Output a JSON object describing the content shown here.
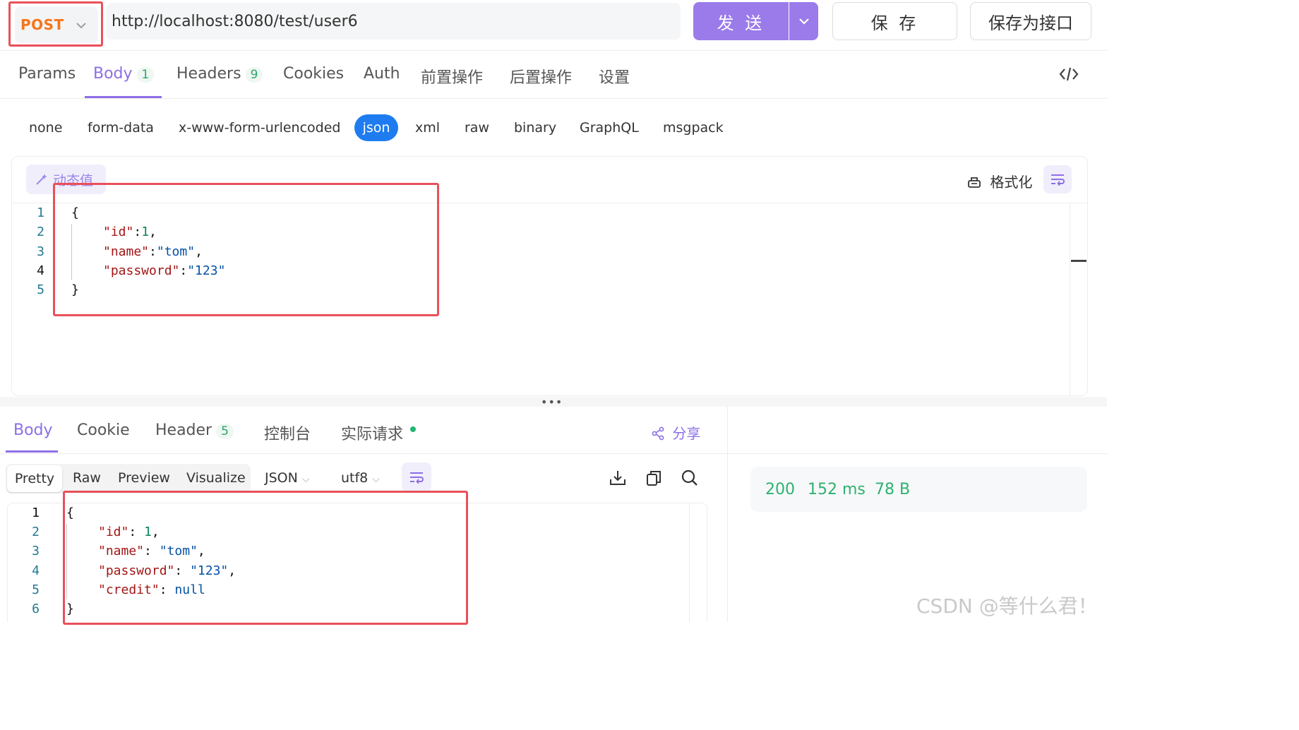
{
  "request": {
    "method": "POST",
    "url": "http://localhost:8080/test/user6",
    "send_label": "发 送",
    "save_label": "保 存",
    "save_api_label": "保存为接口"
  },
  "req_tabs": [
    {
      "label": "Params"
    },
    {
      "label": "Body",
      "badge": "1"
    },
    {
      "label": "Headers",
      "badge": "9"
    },
    {
      "label": "Cookies"
    },
    {
      "label": "Auth"
    },
    {
      "label": "前置操作"
    },
    {
      "label": "后置操作"
    },
    {
      "label": "设置"
    }
  ],
  "body_types": [
    "none",
    "form-data",
    "x-www-form-urlencoded",
    "json",
    "xml",
    "raw",
    "binary",
    "GraphQL",
    "msgpack"
  ],
  "body_type_selected": "json",
  "editor": {
    "dynamic_label": "动态值",
    "format_label": "格式化",
    "line_numbers": [
      "1",
      "2",
      "3",
      "4",
      "5"
    ]
  },
  "request_body": {
    "open": "{",
    "close": "}",
    "id_key": "\"id\"",
    "id_val": "1",
    "name_key": "\"name\"",
    "name_val": "\"tom\"",
    "password_key": "\"password\"",
    "password_val": "\"123\""
  },
  "response": {
    "tabs": [
      {
        "label": "Body"
      },
      {
        "label": "Cookie"
      },
      {
        "label": "Header",
        "badge": "5"
      },
      {
        "label": "控制台"
      },
      {
        "label": "实际请求"
      }
    ],
    "share_label": "分享",
    "views": [
      "Pretty",
      "Raw",
      "Preview",
      "Visualize"
    ],
    "format_select": "JSON",
    "encoding_select": "utf8",
    "line_numbers": [
      "1",
      "2",
      "3",
      "4",
      "5",
      "6"
    ],
    "body": {
      "open": "{",
      "close": "}",
      "id_key": "\"id\"",
      "id_val": "1",
      "name_key": "\"name\"",
      "name_val": "\"tom\"",
      "password_key": "\"password\"",
      "password_val": "\"123\"",
      "credit_key": "\"credit\"",
      "credit_val": "null"
    },
    "status": {
      "code": "200",
      "time": "152 ms",
      "size": "78 B"
    }
  },
  "watermark": "CSDN @等什么君！",
  "colors": {
    "accent": "#8d6fe6",
    "method": "#f5761a",
    "json_pill": "#1e7cf0",
    "status_ok": "#2fb170",
    "highlight_box": "#e8505b"
  }
}
